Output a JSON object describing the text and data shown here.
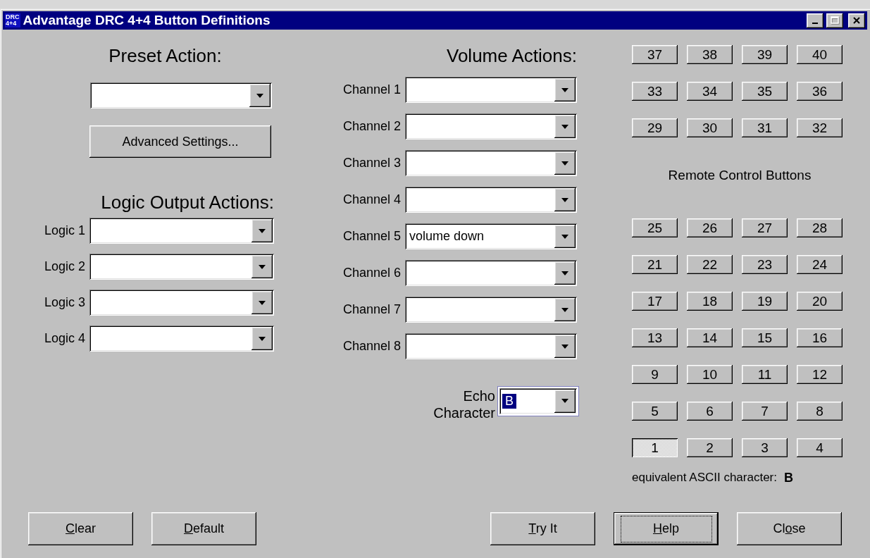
{
  "window": {
    "title": "Advantage DRC 4+4 Button Definitions",
    "icon_lines": [
      "DRC",
      "4+4"
    ],
    "controls": [
      {
        "kind": "minimize",
        "disabled": false
      },
      {
        "kind": "maximize",
        "disabled": true
      },
      {
        "kind": "close",
        "disabled": false
      }
    ]
  },
  "preset": {
    "heading": "Preset Action:",
    "button": "Advanced Settings..."
  },
  "logic": {
    "heading": "Logic Output Actions:",
    "rows": [
      {
        "label": "Logic 1"
      },
      {
        "label": "Logic 2"
      },
      {
        "label": "Logic 3"
      },
      {
        "label": "Logic 4"
      }
    ]
  },
  "volume": {
    "heading": "Volume Actions:",
    "rows": [
      {
        "label": "Channel 1"
      },
      {
        "label": "Channel 2"
      },
      {
        "label": "Channel 3"
      },
      {
        "label": "Channel 4"
      },
      {
        "label": "Channel 5",
        "value": "volume down"
      },
      {
        "label": "Channel 6"
      },
      {
        "label": "Channel 7"
      },
      {
        "label": "Channel 8"
      }
    ]
  },
  "echo": {
    "label_lines": [
      "Echo",
      "Character"
    ],
    "value": "B",
    "focused": true
  },
  "remote": {
    "top_rows": [
      [
        {
          "label": "37",
          "selected": false
        },
        {
          "label": "38",
          "selected": false
        },
        {
          "label": "39",
          "selected": false
        },
        {
          "label": "40",
          "selected": false
        }
      ],
      [
        {
          "label": "33",
          "selected": false
        },
        {
          "label": "34",
          "selected": false
        },
        {
          "label": "35",
          "selected": false
        },
        {
          "label": "36",
          "selected": false
        }
      ],
      [
        {
          "label": "29",
          "selected": false
        },
        {
          "label": "30",
          "selected": false
        },
        {
          "label": "31",
          "selected": false
        },
        {
          "label": "32",
          "selected": false
        }
      ]
    ],
    "heading": "Remote Control Buttons",
    "bottom_rows": [
      [
        {
          "label": "25",
          "selected": false
        },
        {
          "label": "26",
          "selected": false
        },
        {
          "label": "27",
          "selected": false
        },
        {
          "label": "28",
          "selected": false
        }
      ],
      [
        {
          "label": "21",
          "selected": false
        },
        {
          "label": "22",
          "selected": false
        },
        {
          "label": "23",
          "selected": false
        },
        {
          "label": "24",
          "selected": false
        }
      ],
      [
        {
          "label": "17",
          "selected": false
        },
        {
          "label": "18",
          "selected": false
        },
        {
          "label": "19",
          "selected": false
        },
        {
          "label": "20",
          "selected": false
        }
      ],
      [
        {
          "label": "13",
          "selected": false
        },
        {
          "label": "14",
          "selected": false
        },
        {
          "label": "15",
          "selected": false
        },
        {
          "label": "16",
          "selected": false
        }
      ],
      [
        {
          "label": "9",
          "selected": false
        },
        {
          "label": "10",
          "selected": false
        },
        {
          "label": "11",
          "selected": false
        },
        {
          "label": "12",
          "selected": false
        }
      ],
      [
        {
          "label": "5",
          "selected": false
        },
        {
          "label": "6",
          "selected": false
        },
        {
          "label": "7",
          "selected": false
        },
        {
          "label": "8",
          "selected": false
        }
      ],
      [
        {
          "label": "1",
          "selected": true
        },
        {
          "label": "2",
          "selected": false
        },
        {
          "label": "3",
          "selected": false
        },
        {
          "label": "4",
          "selected": false
        }
      ]
    ],
    "ascii_label": "equivalent ASCII character:",
    "ascii_value": "B"
  },
  "left_buttons": [
    {
      "key": "C",
      "after": "lear",
      "default": false
    },
    {
      "key": "D",
      "after": "efault",
      "default": false
    }
  ],
  "right_buttons": [
    {
      "key": "T",
      "after": "ry It",
      "default": false
    },
    {
      "key": "H",
      "after": "elp",
      "default": true
    },
    {
      "before": "Cl",
      "key": "o",
      "after": "se",
      "default": false
    }
  ]
}
